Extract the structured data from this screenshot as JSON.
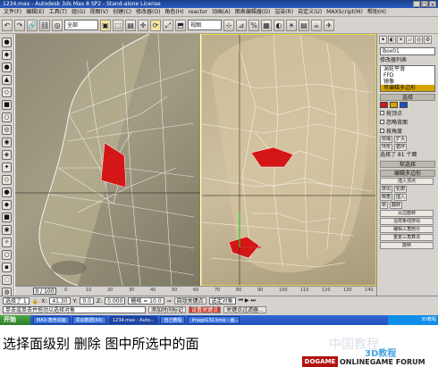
{
  "window": {
    "title": "1234.max - Autodesk 3ds Max 8 SP2 - Stand-alone License",
    "buttons": [
      "_",
      "□",
      "×"
    ]
  },
  "menu": [
    "文件(F)",
    "编辑(E)",
    "工具(T)",
    "组(G)",
    "视图(V)",
    "创建(C)",
    "修改器(O)",
    "角色(H)",
    "reactor",
    "动画(A)",
    "图表编辑器(D)",
    "渲染(R)",
    "自定义(U)",
    "MAXScript(M)",
    "帮助(H)"
  ],
  "toolbar": {
    "selection_filter": "全部",
    "view_dropdown": "视图",
    "icons": [
      "↶",
      "↷",
      "🔗",
      "⛓",
      "◎",
      "▣",
      "⬚",
      "▤",
      "✛",
      "⟳",
      "⤢",
      "⬒",
      "⊹",
      "⊿",
      "%",
      "▦",
      "◐",
      "☀",
      "▤",
      "☕",
      "✈"
    ]
  },
  "left_tools": [
    "●",
    "◆",
    "●",
    "▲",
    "◇",
    "■",
    "○",
    "◎",
    "◉",
    "◈",
    "✦",
    "◇",
    "●",
    "◆",
    "■",
    "◉",
    "✧",
    "○",
    "▪",
    "◌",
    "◍",
    "●"
  ],
  "viewports": {
    "left": {
      "label": ""
    },
    "right": {
      "label": ""
    }
  },
  "command_panel": {
    "tab_icons": [
      "✦",
      "◐",
      "✕",
      "▱",
      "◎",
      "⚙"
    ],
    "object_name": "Box01",
    "modifier_list_label": "修改器列表",
    "stack": [
      {
        "label": "涡轮平滑",
        "selected": false
      },
      {
        "label": "FFD",
        "selected": false
      },
      {
        "label": "镜像",
        "selected": false
      },
      {
        "label": "可编辑多边形",
        "selected": true
      }
    ],
    "selection_rollout": "选择",
    "checkboxes": [
      "按顶点",
      "忽略背面",
      "按角度"
    ],
    "buttons_row1": [
      "收缩",
      "扩大"
    ],
    "buttons_row2": [
      "环形",
      "循环"
    ],
    "selected_count": "选择了 81 个面",
    "soft_select_rollout": "软选择",
    "edit_poly_rollout": "编辑多边形",
    "insert_vertex": "插入顶点",
    "buttons_row3": [
      "挤出",
      "轮廓"
    ],
    "buttons_row4": [
      "倒角",
      "插入"
    ],
    "buttons_row5": [
      "桥",
      "翻转"
    ],
    "extra_buttons": [
      "从边旋转",
      "沿样条线挤出",
      "编辑三角剖分",
      "重复三角算法",
      "旋转"
    ],
    "swatch_colors": [
      "#d41616",
      "#d8a400",
      "#2050c0"
    ]
  },
  "timeline": {
    "frame": "0 / 100",
    "ticks": [
      "0",
      "10",
      "20",
      "30",
      "40",
      "50",
      "60",
      "70",
      "80",
      "90",
      "100",
      "110",
      "120",
      "130",
      "140"
    ]
  },
  "status": {
    "selected": "选择了 1",
    "x_label": "X:",
    "x_value": "41.30",
    "y_label": "Y:",
    "y_value": "0.0",
    "z_label": "Z:",
    "z_value": "0.000",
    "grid": "栅格 = 10.0",
    "autokey": "自动关键点",
    "selected_object": "选定对象",
    "set_key": "设置关键点",
    "key_filters": "关键点过滤器...",
    "prompt": "单击或单击并拖动以选择对象",
    "add_time_tag": "添加时间标记"
  },
  "taskbar": {
    "start": "开始",
    "tasks": [
      "MAX-角色动画",
      "机动数据(64)",
      "1234.max - Auto...",
      "自己教程",
      "Image132.bmp - 画..."
    ],
    "active_task_index": 2,
    "tray_text": "3D教程"
  },
  "caption": "选择面级别 删除 图中所选中的面",
  "brand": {
    "logo_text": "DOGAME",
    "sub_text": "ONLINEGAME FORUM",
    "site_text": "3D教程",
    "watermark": "中国教程"
  }
}
